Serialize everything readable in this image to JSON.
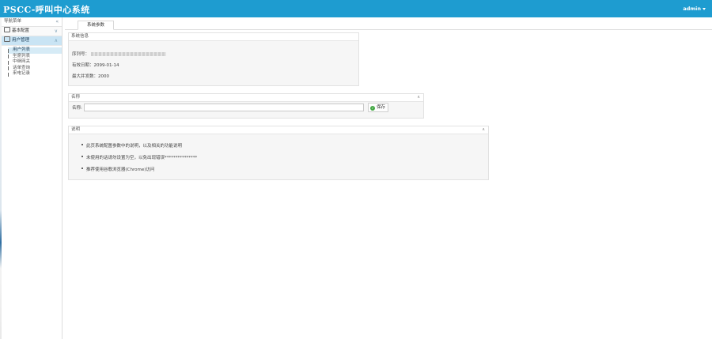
{
  "header": {
    "title": "PSCC-呼叫中心系统",
    "user": "admin"
  },
  "sidebar": {
    "title": "导航菜单",
    "collapse_icon": "«",
    "groups": [
      {
        "label": "基本配置",
        "chevron": "∨"
      },
      {
        "label": "用户管理",
        "chevron": "∧"
      }
    ],
    "items": [
      "用户列表",
      "坐席列表",
      "中继网关",
      "话单查询",
      "来电记录"
    ],
    "selected_index": 0
  },
  "tabs": [
    {
      "label": "系统参数"
    }
  ],
  "system_params": {
    "title": "系统信息",
    "serial_label": "序列号：",
    "expiry": "有效日期：2099-01-14",
    "max_concurrency": "最大并发数：2000"
  },
  "name_panel": {
    "title": "名称",
    "toggle": "∧",
    "field_label": "名称:",
    "input_value": "",
    "save_label": "保存"
  },
  "notes_panel": {
    "title": "说明",
    "toggle": "∧",
    "items": [
      "此页系统配置参数中的说明，以及相关的功能说明",
      "未使用的话请勿设置为空，以免出现错误***************",
      "推荐使用谷歌浏览器(Chrome)访问"
    ]
  }
}
